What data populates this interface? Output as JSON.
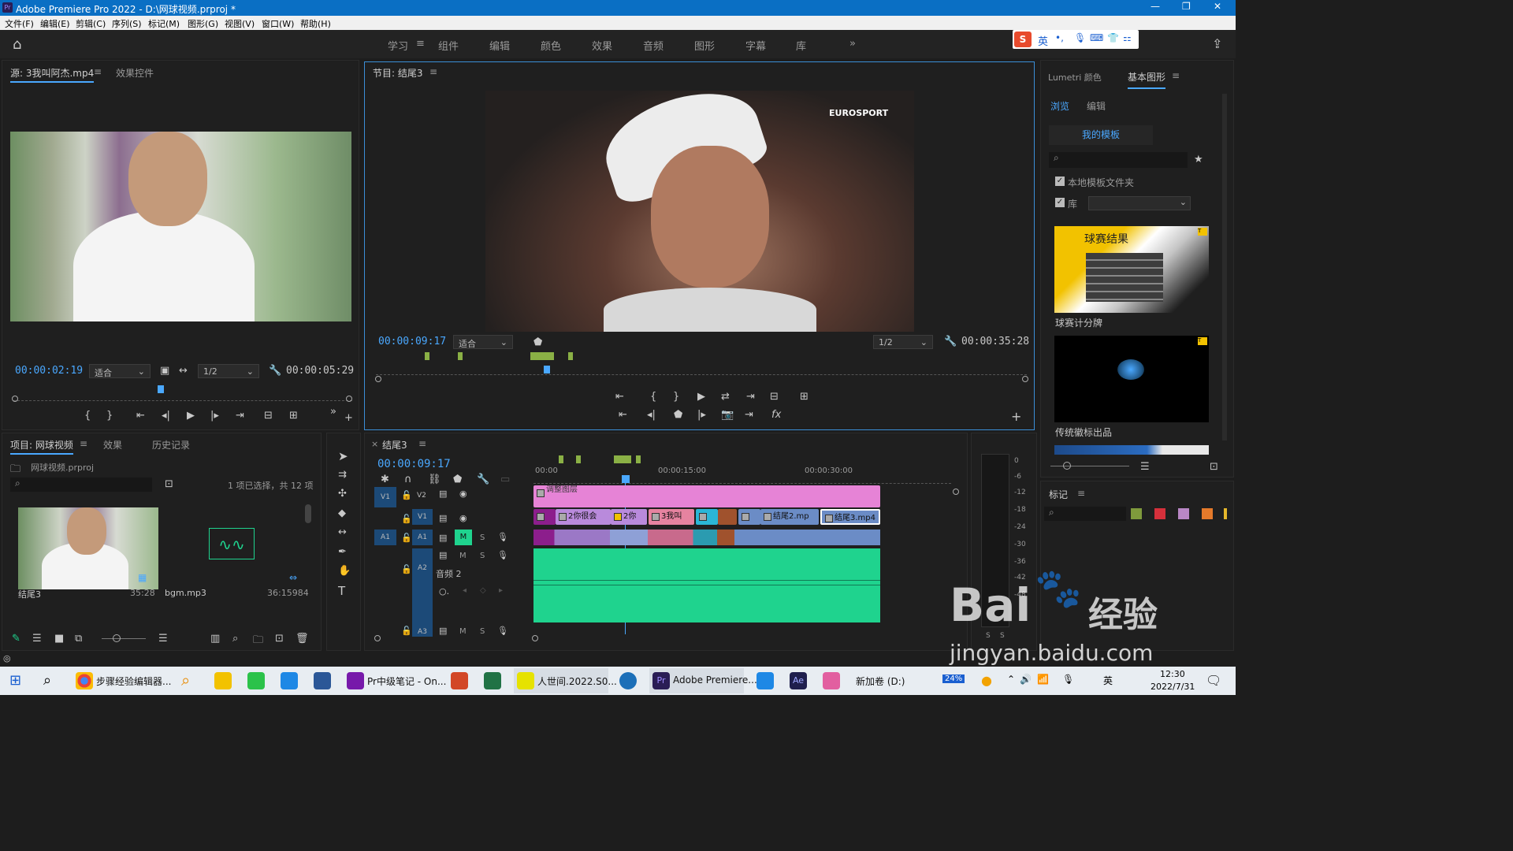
{
  "window": {
    "title": "Adobe Premiere Pro 2022 - D:\\网球视频.prproj *"
  },
  "menu": [
    "文件(F)",
    "编辑(E)",
    "剪辑(C)",
    "序列(S)",
    "标记(M)",
    "图形(G)",
    "视图(V)",
    "窗口(W)",
    "帮助(H)"
  ],
  "workspaces": [
    "学习",
    "组件",
    "编辑",
    "颜色",
    "效果",
    "音频",
    "图形",
    "字幕",
    "库"
  ],
  "workspace_more": "»",
  "ime": {
    "lang": "英",
    "punct": "•,"
  },
  "source": {
    "tab_active": "源: 3我叫阿杰.mp4",
    "tab_other": "效果控件",
    "timecode": "00:00:02:19",
    "fit": "适合",
    "res": "1/2",
    "duration": "00:00:05:29"
  },
  "program": {
    "tab": "节目: 结尾3",
    "timecode": "00:00:09:17",
    "fit": "适合",
    "res": "1/2",
    "duration": "00:00:35:28",
    "watermark": "EUROSPORT"
  },
  "project": {
    "tabs": [
      "项目: 网球视频",
      "效果",
      "历史记录"
    ],
    "file": "网球视频.prproj",
    "selection": "1 项已选择，共 12 项",
    "items": [
      {
        "name": "结尾3",
        "dur": "35:28"
      },
      {
        "name": "bgm.mp3",
        "dur": "36:15984"
      }
    ]
  },
  "timeline": {
    "tab": "结尾3",
    "timecode": "00:00:09:17",
    "ruler": [
      "00:00",
      "00:00:15:00",
      "00:00:30:00"
    ],
    "v2clip": "调整图层",
    "v1clips": [
      "2你很会",
      "2你",
      "3我叫",
      "",
      "",
      "",
      "结尾2.mp",
      "结尾3.mp4"
    ],
    "tracks": {
      "v2": "V2",
      "v1": "V1",
      "a1": "A1",
      "a2": "A2",
      "a3": "A3",
      "src_v": "V1",
      "src_a": "A1",
      "audio2": "音频 2"
    },
    "m": "M",
    "s": "S",
    "levels": [
      "0",
      "-6",
      "-12",
      "-18",
      "-24",
      "-30",
      "-36",
      "-42",
      "-48"
    ]
  },
  "right": {
    "tabs": [
      "Lumetri 颜色",
      "基本图形"
    ],
    "subtabs": [
      "浏览",
      "编辑"
    ],
    "my_templates": "我的模板",
    "check_local": "本地模板文件夹",
    "check_lib": "库",
    "templates": [
      {
        "name": "球赛计分牌",
        "thumb_title": "球赛结果"
      },
      {
        "name": "传统徽标出品"
      }
    ],
    "markers": "标记"
  },
  "taskbar": {
    "items": [
      "步骤经验编辑器...",
      "Pr中级笔记 - On...",
      "人世间.2022.S0...",
      "Adobe Premiere..."
    ],
    "drive": "新加卷 (D:)",
    "battery": "24%",
    "time": "12:30",
    "date": "2022/7/31"
  },
  "baidu": {
    "logo": "Bai",
    "text": "经验",
    "url": "jingyan.baidu.com"
  },
  "colors": {
    "accent": "#4aa8ff",
    "titlebar": "#0a6fc4",
    "audio": "#1fd38e",
    "adj": "#e683d6"
  }
}
